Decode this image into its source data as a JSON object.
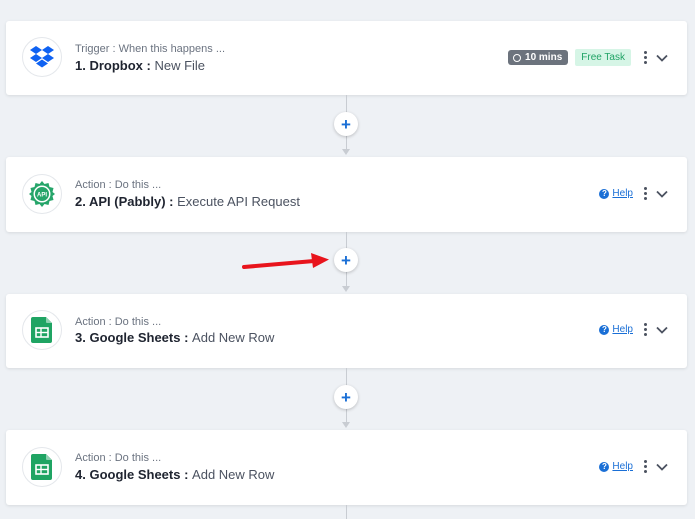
{
  "steps": [
    {
      "kicker": "Trigger : When this happens ...",
      "title": "1. Dropbox :",
      "subtitle": "New File",
      "app_icon": "dropbox-icon",
      "time_badge": "10 mins",
      "free_badge": "Free Task"
    },
    {
      "kicker": "Action : Do this ...",
      "title": "2. API (Pabbly) :",
      "subtitle": "Execute API Request",
      "app_icon": "api-icon",
      "help_label": "Help"
    },
    {
      "kicker": "Action : Do this ...",
      "title": "3. Google Sheets :",
      "subtitle": "Add New Row",
      "app_icon": "google-sheets-icon",
      "help_label": "Help"
    },
    {
      "kicker": "Action : Do this ...",
      "title": "4. Google Sheets :",
      "subtitle": "Add New Row",
      "app_icon": "google-sheets-icon",
      "help_label": "Help"
    }
  ],
  "connector": {
    "add_label": "+"
  },
  "colors": {
    "accent": "#1a6fd6",
    "arrow": "#e8141c",
    "free_bg": "#d6f5e6",
    "free_text": "#20a365"
  }
}
